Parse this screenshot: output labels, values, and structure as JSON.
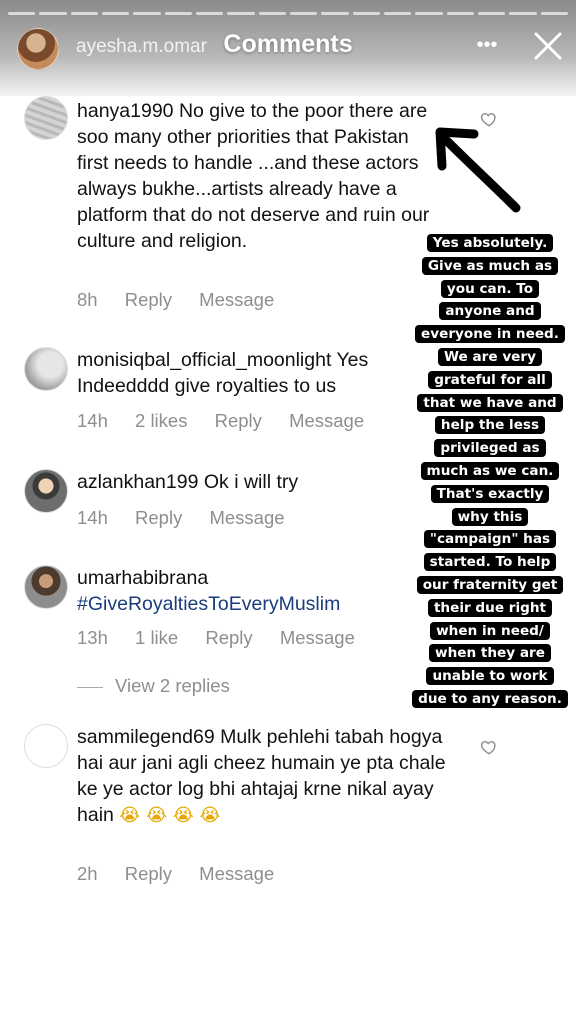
{
  "story": {
    "username": "ayesha.m.omar",
    "title": "Comments"
  },
  "comments": [
    {
      "username": "hanya1990",
      "text": "No give to the poor there are soo many other priorities that Pakistan first needs to handle ...and these actors always bukhe...artists already have a platform that do not deserve and ruin our culture and religion.",
      "time": "8h",
      "likes": "",
      "reply_label": "Reply",
      "message_label": "Message"
    },
    {
      "username": "monisiqbal_official_moonlight",
      "text": "Yes Indeedddd give royalties to us",
      "time": "14h",
      "likes": "2 likes",
      "reply_label": "Reply",
      "message_label": "Message"
    },
    {
      "username": "azlankhan199",
      "text": "Ok i will try",
      "time": "14h",
      "likes": "",
      "reply_label": "Reply",
      "message_label": "Message"
    },
    {
      "username": "umarhabibrana",
      "text": "#GiveRoyaltiesToEveryMuslim",
      "time": "13h",
      "likes": "1 like",
      "reply_label": "Reply",
      "message_label": "Message",
      "view_replies": "View 2 replies"
    },
    {
      "username": "sammilegend69",
      "text": "Mulk pehlehi tabah hogya hai aur jani agli cheez humain ye pta chale ke ye actor log bhi ahtajaj krne nikal ayay hain",
      "emoji": "😭 😭 😭 😭",
      "time": "2h",
      "likes": "",
      "reply_label": "Reply",
      "message_label": "Message"
    }
  ],
  "sticker": {
    "lines": [
      "Yes absolutely.",
      "Give as much as",
      "you can. To",
      "anyone and",
      "everyone in need.",
      "We are very",
      "grateful for all",
      "that we have and",
      "help the less",
      "privileged as",
      "much as we can.",
      "That's exactly",
      "why this",
      "\"campaign\" has",
      "started. To help",
      "our fraternity get",
      "their due right",
      "when in need/",
      "when they are",
      "unable to work",
      "due to any reason."
    ]
  },
  "icons": {
    "more": "more-dots-icon",
    "close": "close-icon",
    "heart": "heart-outline-icon",
    "arrow": "hand-drawn-arrow"
  }
}
